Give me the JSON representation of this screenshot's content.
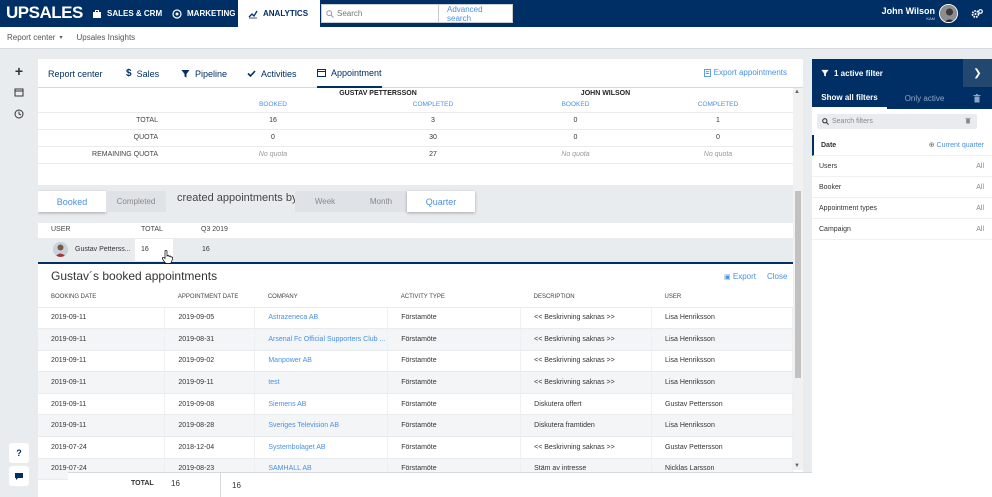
{
  "topbar": {
    "logo": "UPSALES",
    "tabs": [
      {
        "label": "SALES & CRM",
        "icon": "briefcase-icon"
      },
      {
        "label": "MARKETING",
        "icon": "target-icon"
      },
      {
        "label": "ANALYTICS",
        "icon": "chart-line-icon"
      }
    ],
    "search_placeholder": "Search",
    "advanced_search": "Advanced search",
    "user_name": "John Wilson",
    "user_role": "KAM"
  },
  "subbar": {
    "report_center": "Report center",
    "insights": "Upsales Insights"
  },
  "report_tabs": [
    {
      "label": "Report center",
      "icon": ""
    },
    {
      "label": "Sales",
      "icon": "dollar-icon"
    },
    {
      "label": "Pipeline",
      "icon": "funnel-icon"
    },
    {
      "label": "Activities",
      "icon": "check-icon"
    },
    {
      "label": "Appointment",
      "icon": "calendar-icon"
    }
  ],
  "export_appointments": "Export appointments",
  "quota": {
    "users": [
      "GUSTAV PETTERSSON",
      "JOHN WILSON"
    ],
    "columns": [
      "BOOKED",
      "COMPLETED",
      "BOOKED",
      "COMPLETED"
    ],
    "rows": [
      {
        "label": "TOTAL",
        "values": [
          "16",
          "3",
          "0",
          "1"
        ]
      },
      {
        "label": "QUOTA",
        "values": [
          "0",
          "30",
          "0",
          "0"
        ]
      },
      {
        "label": "REMAINING QUOTA",
        "values": [
          "No quota",
          "27",
          "No quota",
          "No quota"
        ]
      }
    ]
  },
  "controls": {
    "booked": "Booked",
    "completed": "Completed",
    "created_by": "created appointments by",
    "week": "Week",
    "month": "Month",
    "quarter": "Quarter"
  },
  "user_table": {
    "headers": [
      "USER",
      "TOTAL",
      "Q3 2019"
    ],
    "row": {
      "user": "Gustav Petterss...",
      "total": "16",
      "q3": "16"
    }
  },
  "detail": {
    "title": "Gustav´s booked appointments",
    "export": "Export",
    "close": "Close",
    "headers": [
      "BOOKING DATE",
      "APPOINTMENT DATE",
      "COMPANY",
      "ACTIVITY TYPE",
      "DESCRIPTION",
      "USER"
    ],
    "rows": [
      [
        "2019-09-11",
        "2019-09-05",
        "Astrazeneca AB",
        "Förstamöte",
        "<< Beskrivning saknas >>",
        "Lisa Henriksson"
      ],
      [
        "2019-09-11",
        "2019-08-31",
        "Arsenal Fc Official Supporters Club ...",
        "Förstamöte",
        "<< Beskrivning saknas >>",
        "Lisa Henriksson"
      ],
      [
        "2019-09-11",
        "2019-09-02",
        "Manpower AB",
        "Förstamöte",
        "<< Beskrivning saknas >>",
        "Lisa Henriksson"
      ],
      [
        "2019-09-11",
        "2019-09-11",
        "test",
        "Förstamöte",
        "<< Beskrivning saknas >>",
        "Lisa Henriksson"
      ],
      [
        "2019-09-11",
        "2019-09-08",
        "Siemens AB",
        "Förstamöte",
        "Diskutera offert",
        "Gustav Pettersson"
      ],
      [
        "2019-09-11",
        "2019-08-28",
        "Sveriges Television AB",
        "Förstamöte",
        "Diskutera framtiden",
        "Lisa Henriksson"
      ],
      [
        "2019-07-24",
        "2018-12-04",
        "Systembolaget AB",
        "Förstamöte",
        "<< Beskrivning saknas >>",
        "Gustav Pettersson"
      ],
      [
        "2019-07-24",
        "2019-08-23",
        "SAMHALL AB",
        "Förstamöte",
        "Stäm av intresse",
        "Nicklas Larsson"
      ]
    ]
  },
  "footer": {
    "label": "TOTAL",
    "total": "16",
    "q3": "16"
  },
  "filters": {
    "header": "1 active filter",
    "show_all": "Show all filters",
    "only_active": "Only active",
    "search_placeholder": "Search filters",
    "items": [
      {
        "label": "Date",
        "value": "Current quarter"
      },
      {
        "label": "Users",
        "value": "All"
      },
      {
        "label": "Booker",
        "value": "All"
      },
      {
        "label": "Appointment types",
        "value": "All"
      },
      {
        "label": "Campaign",
        "value": "All"
      }
    ]
  },
  "leftrail": {
    "help": "?"
  }
}
